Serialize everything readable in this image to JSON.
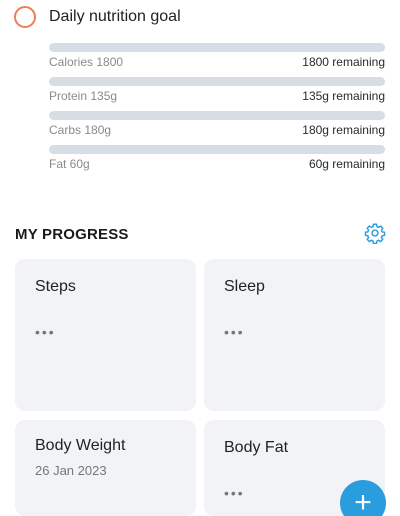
{
  "goal": {
    "title": "Daily nutrition goal"
  },
  "nutrients": [
    {
      "label": "Calories 1800",
      "remaining": "1800 remaining",
      "progress": 0
    },
    {
      "label": "Protein 135g",
      "remaining": "135g remaining",
      "progress": 0
    },
    {
      "label": "Carbs 180g",
      "remaining": "180g remaining",
      "progress": 0
    },
    {
      "label": "Fat 60g",
      "remaining": "60g remaining",
      "progress": 0
    }
  ],
  "progress": {
    "title": "MY PROGRESS",
    "settings_icon": "gear-icon",
    "cards": [
      {
        "title": "Steps",
        "value": "•••"
      },
      {
        "title": "Sleep",
        "value": "•••"
      },
      {
        "title": "Body Weight",
        "date": "26 Jan 2023"
      },
      {
        "title": "Body Fat",
        "value": "•••"
      }
    ]
  },
  "fab": {
    "icon": "plus-icon",
    "label": "+"
  },
  "colors": {
    "accent": "#2a9ddf",
    "ring": "#ee7d52",
    "track": "#d7dde4",
    "card_bg": "#f1f3f7"
  }
}
